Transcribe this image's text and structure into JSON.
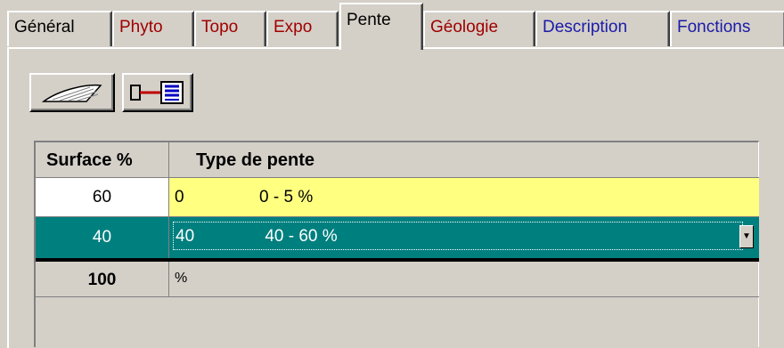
{
  "tabs": [
    {
      "label": "Général",
      "color": "#000000"
    },
    {
      "label": "Phyto",
      "color": "#a00000"
    },
    {
      "label": "Topo",
      "color": "#a00000"
    },
    {
      "label": "Expo",
      "color": "#a00000"
    },
    {
      "label": "Pente",
      "color": "#000000",
      "active": true
    },
    {
      "label": "Géologie",
      "color": "#a00000"
    },
    {
      "label": "Description",
      "color": "#1a1aa8"
    },
    {
      "label": "Fonctions",
      "color": "#1a1aa8"
    }
  ],
  "toolbar": {
    "buttons": [
      {
        "icon": "slope-icon"
      },
      {
        "icon": "link-list-icon"
      }
    ]
  },
  "grid": {
    "columns": [
      "Surface %",
      "Type de pente"
    ],
    "rows": [
      {
        "surface": "60",
        "code": "0",
        "label": "0 - 5 %",
        "state": "highlighted"
      },
      {
        "surface": "40",
        "code": "40",
        "label": "40 - 60 %",
        "state": "selected"
      }
    ],
    "total": {
      "surface": "100",
      "unit": "%"
    }
  },
  "colors": {
    "highlight_row": "#ffff80",
    "selected_row": "#007f7f",
    "background": "#d4d0c8"
  }
}
